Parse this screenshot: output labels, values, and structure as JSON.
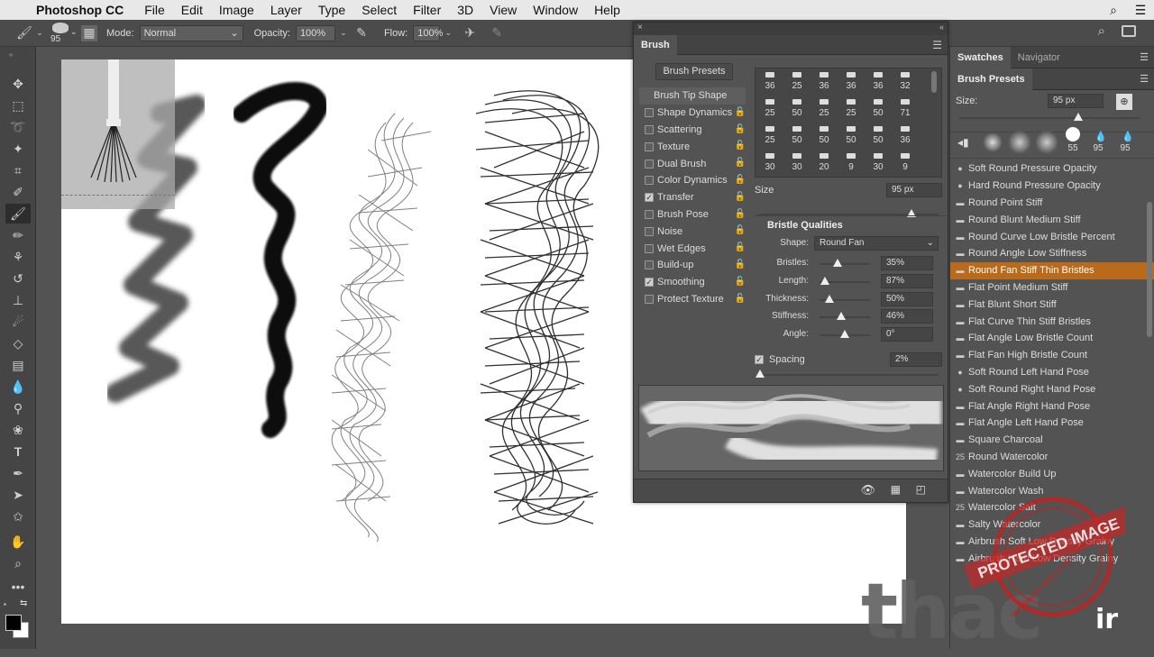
{
  "menubar": {
    "app_name": "Photoshop CC",
    "items": [
      "File",
      "Edit",
      "Image",
      "Layer",
      "Type",
      "Select",
      "Filter",
      "3D",
      "View",
      "Window",
      "Help"
    ]
  },
  "options": {
    "brush_size": "95",
    "mode_label": "Mode:",
    "mode_value": "Normal",
    "opacity_label": "Opacity:",
    "opacity_value": "100%",
    "flow_label": "Flow:",
    "flow_value": "100%"
  },
  "brush_panel": {
    "tab": "Brush",
    "presets_button": "Brush Presets",
    "tip_shape_header": "Brush Tip Shape",
    "options": [
      {
        "label": "Shape Dynamics",
        "checked": false
      },
      {
        "label": "Scattering",
        "checked": false
      },
      {
        "label": "Texture",
        "checked": false
      },
      {
        "label": "Dual Brush",
        "checked": false
      },
      {
        "label": "Color Dynamics",
        "checked": false
      },
      {
        "label": "Transfer",
        "checked": true
      },
      {
        "label": "Brush Pose",
        "checked": false
      },
      {
        "label": "Noise",
        "checked": false
      },
      {
        "label": "Wet Edges",
        "checked": false
      },
      {
        "label": "Build-up",
        "checked": false
      },
      {
        "label": "Smoothing",
        "checked": true
      },
      {
        "label": "Protect Texture",
        "checked": false
      }
    ],
    "tip_sizes": [
      [
        "36",
        "25",
        "36",
        "36",
        "36",
        "32"
      ],
      [
        "25",
        "50",
        "25",
        "25",
        "50",
        "71"
      ],
      [
        "25",
        "50",
        "50",
        "50",
        "50",
        "36"
      ],
      [
        "30",
        "30",
        "20",
        "9",
        "30",
        "9"
      ]
    ],
    "size_label": "Size",
    "size_value": "95 px",
    "size_fraction": 0.85,
    "bristle_header": "Bristle Qualities",
    "shape_label": "Shape:",
    "shape_value": "Round Fan",
    "params": [
      {
        "label": "Bristles:",
        "value": "35%",
        "fraction": 0.35
      },
      {
        "label": "Length:",
        "value": "87%",
        "fraction": 0.1
      },
      {
        "label": "Thickness:",
        "value": "50%",
        "fraction": 0.2
      },
      {
        "label": "Stiffness:",
        "value": "46%",
        "fraction": 0.42
      },
      {
        "label": "Angle:",
        "value": "0°",
        "fraction": 0.5
      }
    ],
    "spacing_label": "Spacing",
    "spacing_value": "2%",
    "spacing_checked": true
  },
  "right_panel": {
    "tabs": [
      "Swatches",
      "Navigator"
    ],
    "sub_tab": "Brush Presets",
    "size_label": "Size:",
    "size_value": "95 px",
    "thumb_sizes": [
      "55",
      "95",
      "95"
    ],
    "presets": [
      {
        "label": "Soft Round Pressure Opacity",
        "icon": "●"
      },
      {
        "label": "Hard Round Pressure Opacity",
        "icon": "●"
      },
      {
        "label": "Round Point Stiff",
        "icon": "▬"
      },
      {
        "label": "Round Blunt Medium Stiff",
        "icon": "▬"
      },
      {
        "label": "Round Curve Low Bristle Percent",
        "icon": "▬"
      },
      {
        "label": "Round Angle Low Stiffness",
        "icon": "▬"
      },
      {
        "label": "Round Fan Stiff Thin Bristles",
        "icon": "▬",
        "selected": true
      },
      {
        "label": "Flat Point Medium Stiff",
        "icon": "▬"
      },
      {
        "label": "Flat Blunt Short Stiff",
        "icon": "▬"
      },
      {
        "label": "Flat Curve Thin Stiff Bristles",
        "icon": "▬"
      },
      {
        "label": "Flat Angle Low Bristle Count",
        "icon": "▬"
      },
      {
        "label": "Flat Fan High Bristle Count",
        "icon": "▬"
      },
      {
        "label": "Soft Round Left Hand Pose",
        "icon": "●"
      },
      {
        "label": "Soft Round Right Hand Pose",
        "icon": "●"
      },
      {
        "label": "Flat Angle Right Hand Pose",
        "icon": "▬"
      },
      {
        "label": "Flat Angle Left Hand Pose",
        "icon": "▬"
      },
      {
        "label": "Square Charcoal",
        "icon": "▬"
      },
      {
        "label": "Round Watercolor",
        "icon": "25"
      },
      {
        "label": "Watercolor Build Up",
        "icon": "▬"
      },
      {
        "label": "Watercolor Wash",
        "icon": "▬"
      },
      {
        "label": "Watercolor Salt",
        "icon": "25"
      },
      {
        "label": "Salty Watercolor",
        "icon": "▬"
      },
      {
        "label": "Airbrush Soft Low Density Grainy",
        "icon": "▬"
      },
      {
        "label": "Airbrush Hard Low Density Grainy",
        "icon": "▬"
      }
    ]
  },
  "watermark": {
    "stamp_text": "PROTECTED IMAGE",
    "stamp_subtext": "My Website Name & URL Here",
    "logo_text": "thac",
    "logo_text2": "ir"
  },
  "colors": {
    "accent_selected": "#b96a1b",
    "panel_bg": "#535353"
  }
}
